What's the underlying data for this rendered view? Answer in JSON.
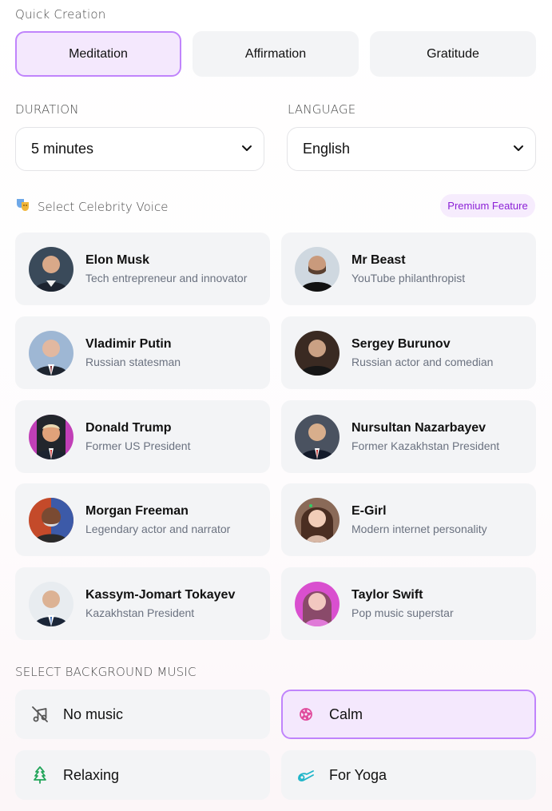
{
  "quick_creation": {
    "label": "Quick Creation",
    "options": [
      "Meditation",
      "Affirmation",
      "Gratitude"
    ],
    "selected": "Meditation"
  },
  "duration": {
    "label": "DURATION",
    "value": "5 minutes"
  },
  "language": {
    "label": "LANGUAGE",
    "value": "English"
  },
  "voices": {
    "label": "Select Celebrity Voice",
    "badge": "Premium Feature",
    "items": [
      {
        "name": "Elon Musk",
        "desc": "Tech entrepreneur and innovator"
      },
      {
        "name": "Mr Beast",
        "desc": "YouTube philanthropist"
      },
      {
        "name": "Vladimir Putin",
        "desc": "Russian statesman"
      },
      {
        "name": "Sergey Burunov",
        "desc": "Russian actor and comedian"
      },
      {
        "name": "Donald Trump",
        "desc": "Former US President"
      },
      {
        "name": "Nursultan Nazarbayev",
        "desc": "Former Kazakhstan President"
      },
      {
        "name": "Morgan Freeman",
        "desc": "Legendary actor and narrator"
      },
      {
        "name": "E-Girl",
        "desc": "Modern internet personality"
      },
      {
        "name": "Kassym-Jomart Tokayev",
        "desc": "Kazakhstan President"
      },
      {
        "name": "Taylor Swift",
        "desc": "Pop music superstar"
      }
    ]
  },
  "music": {
    "label": "SELECT BACKGROUND MUSIC",
    "items": [
      {
        "label": "No music",
        "icon": "music-off-icon"
      },
      {
        "label": "Calm",
        "icon": "flower-icon"
      },
      {
        "label": "Relaxing",
        "icon": "tree-icon"
      },
      {
        "label": "For Yoga",
        "icon": "yoga-mat-icon"
      }
    ],
    "selected": "Calm"
  },
  "colors": {
    "accent": "#c084fc",
    "accent_bg": "#f4e8fd",
    "premium_text": "#8b1fd6",
    "card_bg": "#f3f4f6"
  }
}
